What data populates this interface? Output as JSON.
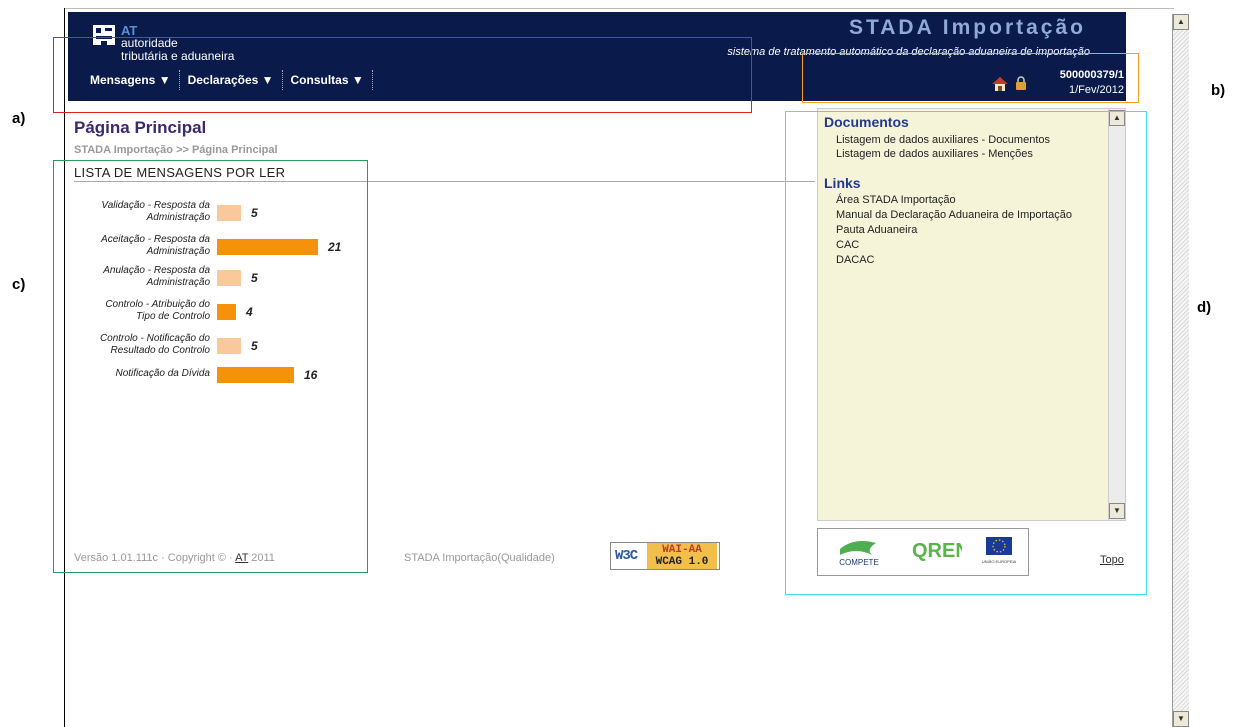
{
  "header": {
    "logo": {
      "acronym": "AT",
      "line1": "autoridade",
      "line2": "tributária e aduaneira"
    },
    "app_title": "STADA Importação",
    "app_subtitle": "sistema de tratamento automático da declaração aduaneira de importação",
    "nav": [
      {
        "label": "Mensagens ▼"
      },
      {
        "label": "Declarações ▼"
      },
      {
        "label": "Consultas ▼"
      }
    ],
    "user_id": "500000379/1",
    "user_date": "1/Fev/2012"
  },
  "page": {
    "title": "Página Principal",
    "breadcrumb": "STADA Importação >> Página Principal",
    "list_title": "LISTA DE MENSAGENS POR LER"
  },
  "chart_data": {
    "type": "bar",
    "orientation": "horizontal",
    "categories": [
      [
        "Validação - Resposta da",
        "Administração"
      ],
      [
        "Aceitação - Resposta da",
        "Administração"
      ],
      [
        "Anulação - Resposta da",
        "Administração"
      ],
      [
        "Controlo - Atribuição do",
        "Tipo de Controlo"
      ],
      [
        "Controlo - Notificação do",
        "Resultado do Controlo"
      ],
      [
        "Notificação da Dívida"
      ]
    ],
    "values": [
      5,
      21,
      5,
      4,
      5,
      16
    ],
    "bar_colors": [
      "#f9c99b",
      "#f5910b",
      "#f9c99b",
      "#f5910b",
      "#f9c99b",
      "#f5910b"
    ]
  },
  "footer": {
    "version_prefix": "Versão 1.01.111c · Copyright © · ",
    "version_link": "AT",
    "version_suffix": " 2011",
    "environment": "STADA Importação(Qualidade)",
    "w3c_left": "W3C",
    "w3c_top": "WAI-AA",
    "w3c_bottom": "WCAG 1.0",
    "topo": "Topo"
  },
  "side": {
    "documentos_title": "Documentos",
    "documentos": [
      "Listagem de dados auxiliares - Documentos",
      "Listagem de dados auxiliares - Menções"
    ],
    "links_title": "Links",
    "links": [
      "Área STADA Importação",
      "Manual da Declaração Aduaneira de Importação",
      "Pauta Aduaneira",
      "CAC",
      "DACAC"
    ],
    "logos": {
      "compete": "COMPETE",
      "qren": "QREN",
      "ue": "UNIÃO EUROPEIA"
    }
  },
  "annotations": {
    "a": "a)",
    "b": "b)",
    "c": "c)",
    "d": "d)",
    "colors": {
      "a": "#e02020",
      "b": "#f5a020",
      "c": "#2e9a5a",
      "d": "#3fe0f0"
    }
  },
  "colors": {
    "header_bg": "#0a1a4a",
    "side_bg": "#f5f3d8",
    "bar_dark": "#f5910b",
    "bar_light": "#f9c99b"
  }
}
